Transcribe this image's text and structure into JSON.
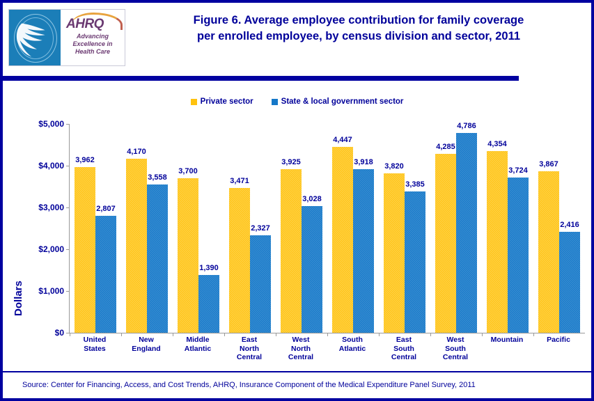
{
  "header": {
    "title_line1": "Figure 6. Average employee contribution for family coverage",
    "title_line2": "per enrolled employee, by census division and sector, 2011",
    "logo": {
      "wordmark": "AHRQ",
      "tagline_line1": "Advancing",
      "tagline_line2": "Excellence in",
      "tagline_line3": "Health Care",
      "seal_name": "hhs-seal"
    }
  },
  "footer": {
    "source": "Source: Center for Financing, Access, and Cost Trends, AHRQ, Insurance Component of the Medical Expenditure Panel Survey,  2011"
  },
  "colors": {
    "private": "#FFC20E",
    "government": "#1578C8",
    "text": "#00009A",
    "border": "#0000A0",
    "axis": "#9a9a9a"
  },
  "chart_data": {
    "type": "bar",
    "title": "Figure 6. Average employee contribution for family coverage per enrolled employee, by census division and sector, 2011",
    "xlabel": "",
    "ylabel": "Dollars",
    "ylim": [
      0,
      5000
    ],
    "ytick_values": [
      0,
      1000,
      2000,
      3000,
      4000,
      5000
    ],
    "ytick_labels": [
      "$0",
      "$1,000",
      "$2,000",
      "$3,000",
      "$4,000",
      "$5,000"
    ],
    "grid": false,
    "legend_position": "top-center",
    "categories": [
      "United States",
      "New England",
      "Middle Atlantic",
      "East North Central",
      "West North Central",
      "South Atlantic",
      "East South Central",
      "West South Central",
      "Mountain",
      "Pacific"
    ],
    "category_lines": [
      [
        "United",
        "States"
      ],
      [
        "New",
        "England"
      ],
      [
        "Middle",
        "Atlantic"
      ],
      [
        "East",
        "North",
        "Central"
      ],
      [
        "West",
        "North",
        "Central"
      ],
      [
        "South",
        "Atlantic"
      ],
      [
        "East",
        "South",
        "Central"
      ],
      [
        "West",
        "South",
        "Central"
      ],
      [
        "Mountain"
      ],
      [
        "Pacific"
      ]
    ],
    "series": [
      {
        "name": "Private sector",
        "color": "#FFC20E",
        "values": [
          3962,
          4170,
          3700,
          3471,
          3925,
          4447,
          3820,
          4285,
          4354,
          3867
        ],
        "labels": [
          "3,962",
          "4,170",
          "3,700",
          "3,471",
          "3,925",
          "4,447",
          "3,820",
          "4,285",
          "4,354",
          "3,867"
        ]
      },
      {
        "name": "State & local government sector",
        "color": "#1578C8",
        "values": [
          2807,
          3558,
          1390,
          2327,
          3028,
          3918,
          3385,
          4786,
          3724,
          2416
        ],
        "labels": [
          "2,807",
          "3,558",
          "1,390",
          "2,327",
          "3,028",
          "3,918",
          "3,385",
          "4,786",
          "3,724",
          "2,416"
        ]
      }
    ]
  }
}
